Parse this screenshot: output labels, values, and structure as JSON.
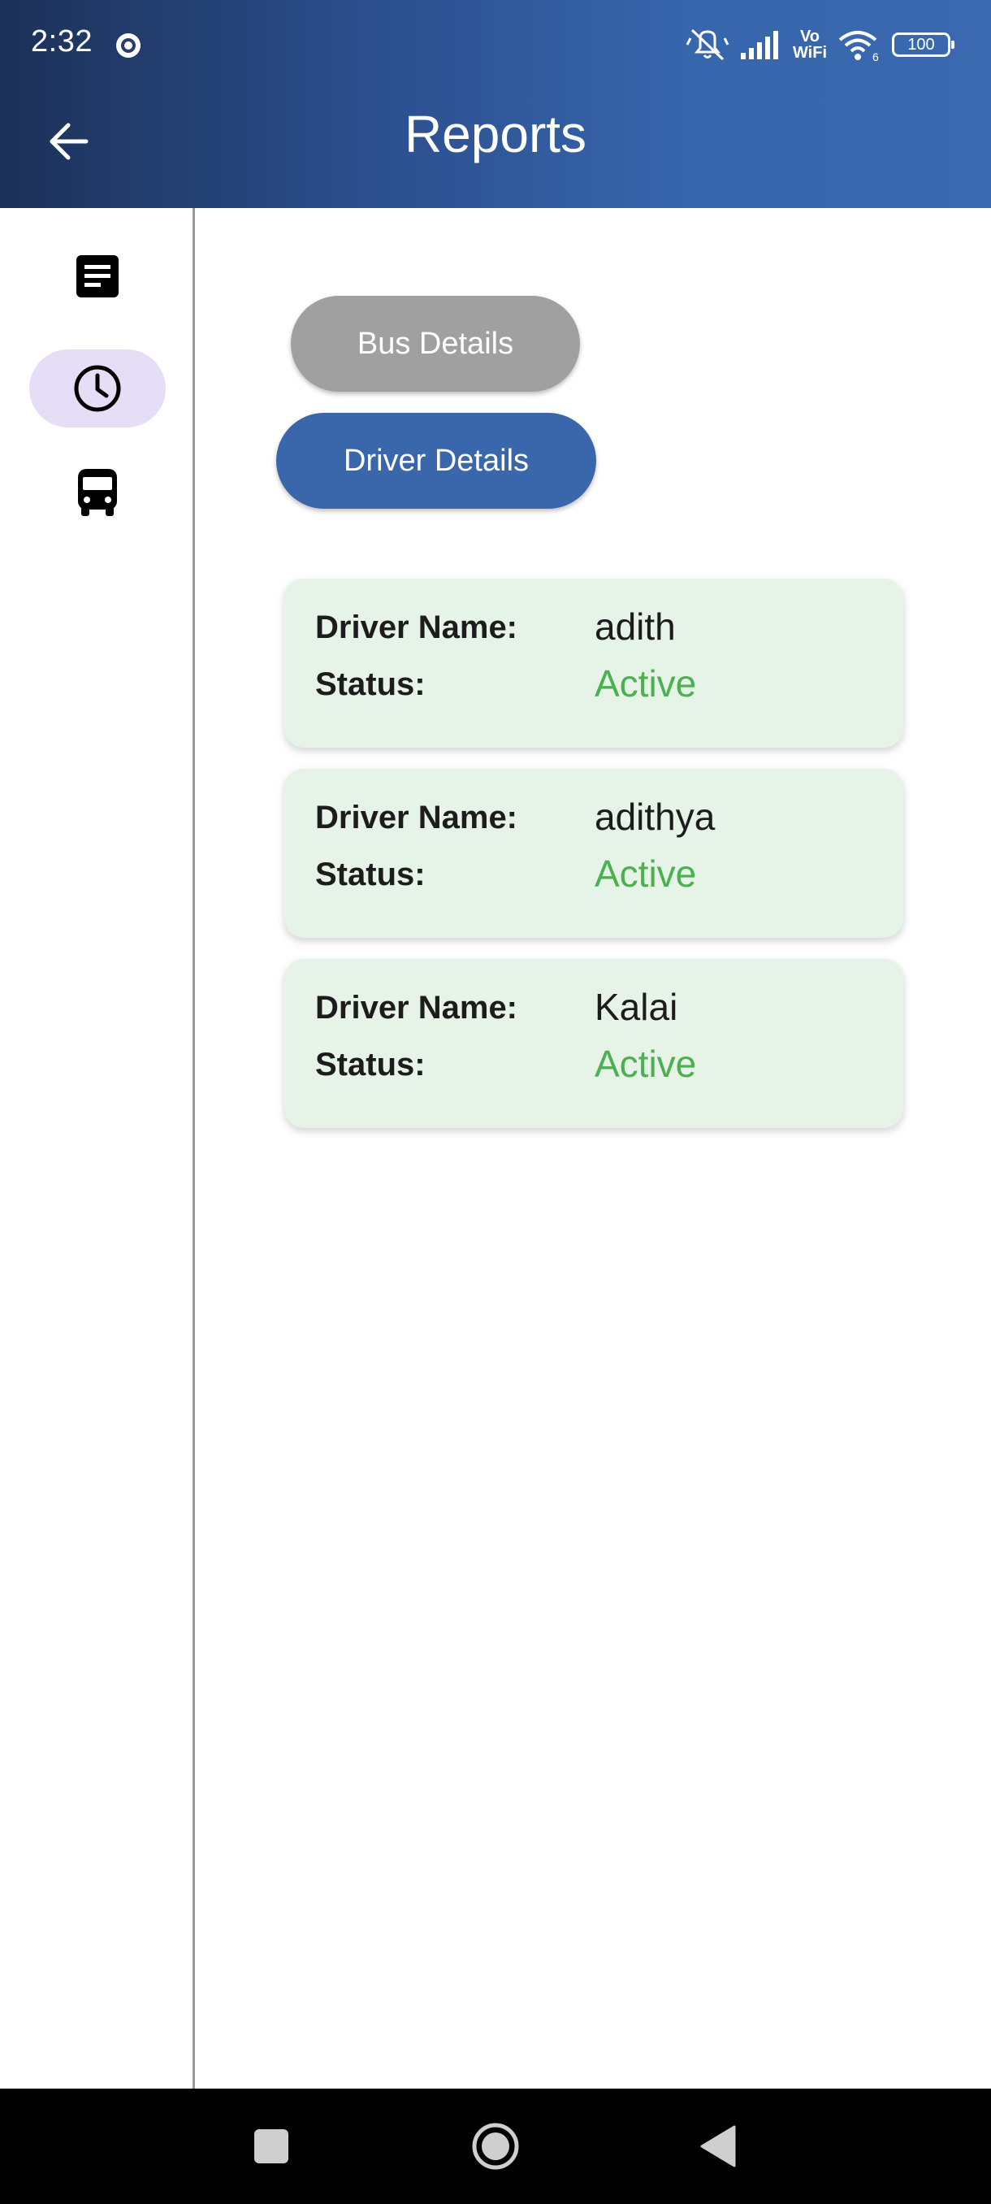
{
  "status_bar": {
    "time": "2:32",
    "voice_wifi_top": "Vo",
    "voice_wifi_bottom": "WiFi",
    "wifi_badge": "6",
    "battery": "100"
  },
  "app_bar": {
    "title": "Reports",
    "back_icon": "arrow-back-icon",
    "color": "#3a66ac"
  },
  "nav_rail": {
    "items": [
      {
        "icon": "document-icon",
        "selected": false
      },
      {
        "icon": "clock-icon",
        "selected": true
      },
      {
        "icon": "bus-icon",
        "selected": false
      }
    ],
    "selected_color": "#e6ddf6"
  },
  "main": {
    "bus_details_label": "Bus Details",
    "driver_details_label": "Driver Details",
    "drivers": [
      {
        "name_label": "Driver Name:",
        "name": "adith",
        "status_label": "Status:",
        "status": "Active"
      },
      {
        "name_label": "Driver Name:",
        "name": "adithya",
        "status_label": "Status:",
        "status": "Active"
      },
      {
        "name_label": "Driver Name:",
        "name": "Kalai",
        "status_label": "Status:",
        "status": "Active"
      }
    ],
    "status_color": "#4caf50",
    "card_color": "#e6f3e7"
  },
  "system_nav": {
    "buttons": [
      "recents-square-icon",
      "home-circle-icon",
      "back-triangle-icon"
    ]
  }
}
